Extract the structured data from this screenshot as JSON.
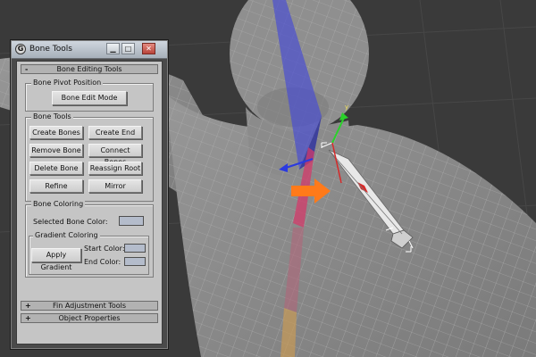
{
  "window": {
    "title": "Bone Tools",
    "icon": "app-logo-icon",
    "app_icon_glyph": "G",
    "controls": {
      "minimize": "▁",
      "maximize": "□",
      "close": "✕"
    }
  },
  "rollouts": {
    "editing": {
      "sign": "-",
      "title": "Bone Editing Tools"
    },
    "fin": {
      "sign": "+",
      "title": "Fin Adjustment Tools"
    },
    "object": {
      "sign": "+",
      "title": "Object Properties"
    }
  },
  "pivot": {
    "label": "Bone Pivot Position",
    "edit_mode": "Bone Edit Mode"
  },
  "tools": {
    "label": "Bone Tools",
    "create_bones": "Create Bones",
    "create_end": "Create End",
    "remove_bone": "Remove Bone",
    "connect_bones": "Connect Bones",
    "delete_bone": "Delete Bone",
    "reassign_root": "Reassign Root",
    "refine": "Refine",
    "mirror": "Mirror"
  },
  "coloring": {
    "label": "Bone Coloring",
    "selected_color_label": "Selected Bone Color:",
    "selected_color": "#b4bccb",
    "gradient": {
      "label": "Gradient Coloring",
      "apply": "Apply Gradient",
      "start_label": "Start Color:",
      "start_color": "#b4bccb",
      "end_label": "End Color:",
      "end_color": "#b4bccb"
    }
  },
  "viewport": {
    "background": "#3a3a3a",
    "mesh_color": "#8a8a8a",
    "arrow_color": "#ff7a1a"
  }
}
